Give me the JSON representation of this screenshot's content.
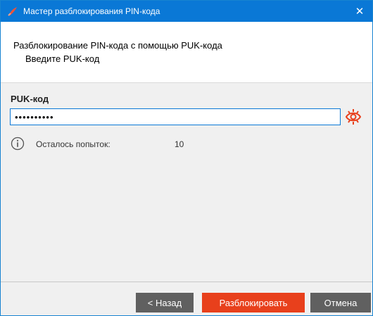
{
  "window": {
    "title": "Мастер разблокирования PIN-кода",
    "close_glyph": "✕"
  },
  "header": {
    "title": "Разблокирование PIN-кода с помощью PUK-кода",
    "subtitle": "Введите PUK-код"
  },
  "form": {
    "puk_label": "PUK-код",
    "puk_value": "••••••••••",
    "show_password_icon": "eye-icon"
  },
  "attempts": {
    "label": "Осталось попыток:",
    "value": "10",
    "icon": "info-icon"
  },
  "buttons": {
    "back": "< Назад",
    "unlock": "Разблокировать",
    "cancel": "Отмена"
  },
  "colors": {
    "titlebar": "#0a78d6",
    "accent_orange": "#e8401c",
    "button_gray": "#606060"
  }
}
